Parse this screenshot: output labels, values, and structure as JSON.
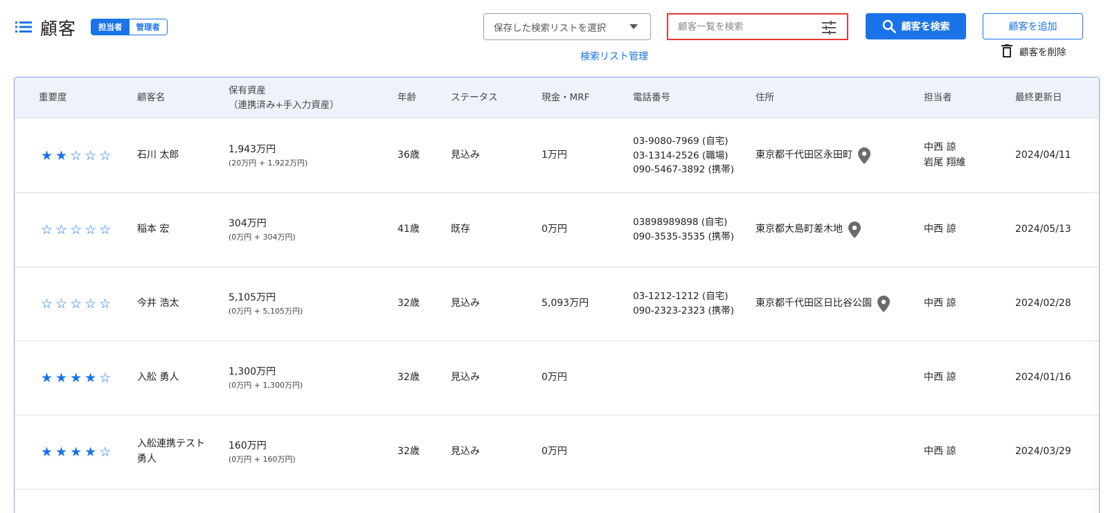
{
  "header": {
    "title": "顧客",
    "roles": [
      "担当者",
      "管理者"
    ],
    "active_role": "担当者",
    "saved_search_placeholder": "保存した検索リストを選択",
    "list_manage_link": "検索リスト管理",
    "search_placeholder": "顧客一覧を検索",
    "search_button": "顧客を検索",
    "add_button": "顧客を追加",
    "delete_button": "顧客を削除"
  },
  "colors": {
    "accent": "#1a73e8",
    "highlight_border": "#e53935",
    "header_bg": "#eef3fb"
  },
  "table": {
    "headers": {
      "importance": "重要度",
      "name": "顧客名",
      "assets_line1": "保有資産",
      "assets_line2": "（連携済み+手入力資産）",
      "age": "年齢",
      "status": "ステータス",
      "cash": "現金・MRF",
      "phone": "電話番号",
      "address": "住所",
      "owner": "担当者",
      "updated": "最終更新日"
    },
    "rows": [
      {
        "stars": 2,
        "name_line1": "石川 太郎",
        "name_line2": "",
        "assets": "1,943万円",
        "assets_detail": "(20万円 + 1,922万円)",
        "age": "36歳",
        "status": "見込み",
        "cash": "1万円",
        "phone1": "03-9080-7969 (自宅)",
        "phone2": "03-1314-2526 (職場)",
        "phone3": "090-5467-3892 (携帯)",
        "address": "東京都千代田区永田町",
        "owner1": "中西 諒",
        "owner2": "岩尾 翔維",
        "updated": "2024/04/11"
      },
      {
        "stars": 0,
        "name_line1": "稲本 宏",
        "name_line2": "",
        "assets": "304万円",
        "assets_detail": "(0万円 + 304万円)",
        "age": "41歳",
        "status": "既存",
        "cash": "0万円",
        "phone1": "03898989898 (自宅)",
        "phone2": "090-3535-3535 (携帯)",
        "phone3": "",
        "address": "東京都大島町差木地",
        "owner1": "中西 諒",
        "owner2": "",
        "updated": "2024/05/13"
      },
      {
        "stars": 0,
        "name_line1": "今井 浩太",
        "name_line2": "",
        "assets": "5,105万円",
        "assets_detail": "(0万円 + 5,105万円)",
        "age": "32歳",
        "status": "見込み",
        "cash": "5,093万円",
        "phone1": "03-1212-1212 (自宅)",
        "phone2": "090-2323-2323 (携帯)",
        "phone3": "",
        "address": "東京都千代田区日比谷公園",
        "owner1": "中西 諒",
        "owner2": "",
        "updated": "2024/02/28"
      },
      {
        "stars": 4,
        "name_line1": "入舩 勇人",
        "name_line2": "",
        "assets": "1,300万円",
        "assets_detail": "(0万円 + 1,300万円)",
        "age": "32歳",
        "status": "見込み",
        "cash": "0万円",
        "phone1": "",
        "phone2": "",
        "phone3": "",
        "address": "",
        "owner1": "中西 諒",
        "owner2": "",
        "updated": "2024/01/16"
      },
      {
        "stars": 4,
        "name_line1": "入舩連携テスト",
        "name_line2": "勇人",
        "assets": "160万円",
        "assets_detail": "(0万円 + 160万円)",
        "age": "32歳",
        "status": "見込み",
        "cash": "0万円",
        "phone1": "",
        "phone2": "",
        "phone3": "",
        "address": "",
        "owner1": "中西 諒",
        "owner2": "",
        "updated": "2024/03/29"
      }
    ]
  }
}
